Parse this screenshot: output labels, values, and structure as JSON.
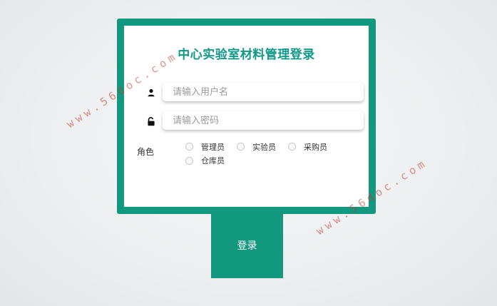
{
  "login": {
    "title": "中心实验室材料管理登录",
    "username": {
      "placeholder": "请输入用户名",
      "value": "",
      "icon": "user-icon"
    },
    "password": {
      "placeholder": "请输入密码",
      "value": "",
      "icon": "lock-icon"
    },
    "role": {
      "label": "角色",
      "options": [
        {
          "label": "管理员"
        },
        {
          "label": "实验员"
        },
        {
          "label": "采购员"
        },
        {
          "label": "仓库员"
        }
      ]
    },
    "submit_label": "登录"
  },
  "watermark": {
    "text": "www.56doc.com"
  },
  "colors": {
    "accent": "#139880",
    "title": "#109889",
    "watermark": "#c0392b"
  }
}
